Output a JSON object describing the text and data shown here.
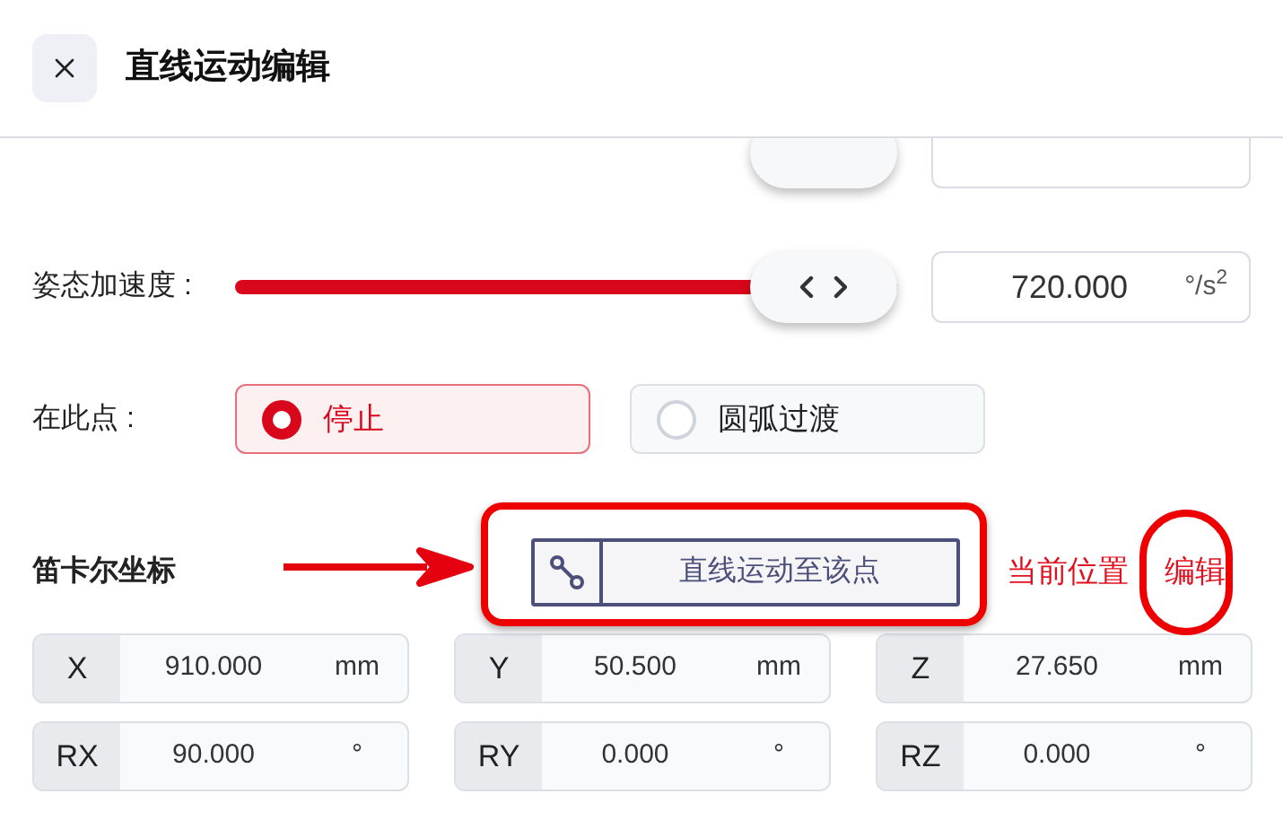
{
  "header": {
    "title": "直线运动编辑"
  },
  "sliders": [
    {
      "label": "姿态加速度 :",
      "level": 1,
      "value": "720.000",
      "unit": "°/s$^{2}$"
    }
  ],
  "at_point": {
    "label": "在此点 :",
    "options": [
      {
        "label": "停止",
        "selected": true
      },
      {
        "label": "圆弧过渡",
        "selected": false
      }
    ]
  },
  "cartesian": {
    "label": "笛卡尔坐标",
    "move_button": "直线运动至该点",
    "current_position": "当前位置",
    "edit": "编辑",
    "fields": [
      {
        "axis": "X",
        "value": "910.000",
        "unit": "mm"
      },
      {
        "axis": "Y",
        "value": "50.500",
        "unit": "mm"
      },
      {
        "axis": "Z",
        "value": "27.650",
        "unit": "mm"
      },
      {
        "axis": "RX",
        "value": "90.000",
        "unit": "°"
      },
      {
        "axis": "RY",
        "value": "0.000",
        "unit": "°"
      },
      {
        "axis": "RZ",
        "value": "0.000",
        "unit": "°"
      }
    ]
  }
}
